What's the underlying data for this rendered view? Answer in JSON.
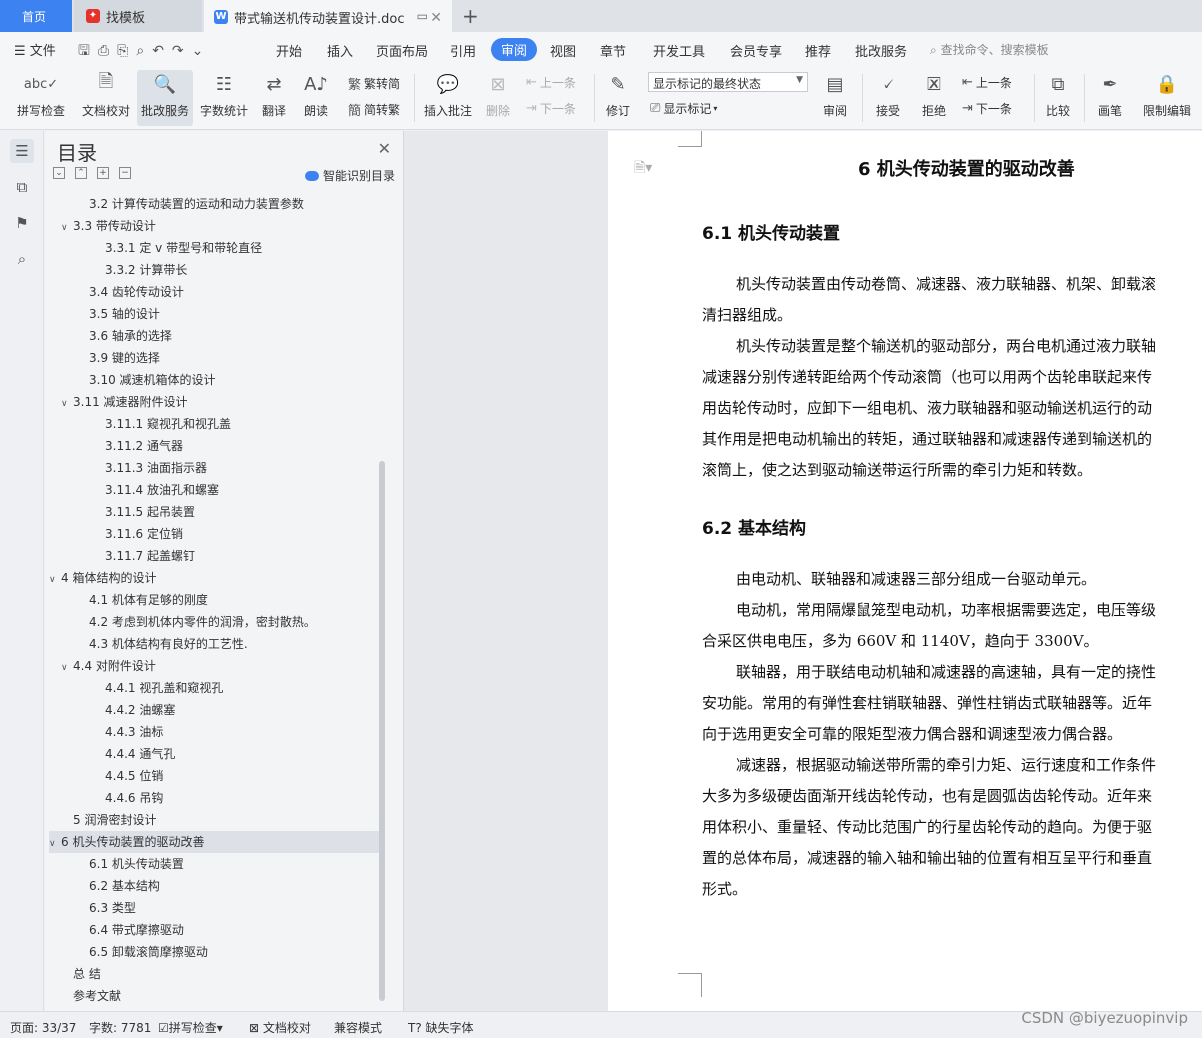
{
  "tabs": {
    "home": "首页",
    "find_template": "找模板",
    "document": "带式输送机传动装置设计.doc"
  },
  "menubar": {
    "file": "文件",
    "items": [
      "开始",
      "插入",
      "页面布局",
      "引用",
      "审阅",
      "视图",
      "章节",
      "开发工具",
      "会员专享",
      "推荐",
      "批改服务"
    ],
    "active": "审阅",
    "search": "查找命令、搜索模板"
  },
  "ribbon": {
    "spellcheck": "拼写检查",
    "doc_proof": "文档校对",
    "grading": "批改服务",
    "word_count": "字数统计",
    "translate": "翻译",
    "read_aloud": "朗读",
    "trad_to_simp": "繁转简",
    "simp_to_trad": "简转繁",
    "insert_comment": "插入批注",
    "delete": "删除",
    "prev_comment": "上一条",
    "next_comment": "下一条",
    "track": "修订",
    "markup_select": "显示标记的最终状态",
    "show_markup": "显示标记",
    "review": "审阅",
    "accept": "接受",
    "reject": "拒绝",
    "prev_change": "上一条",
    "next_change": "下一条",
    "compare": "比较",
    "ink": "画笔",
    "restrict": "限制编辑"
  },
  "toc": {
    "title": "目录",
    "smart": "智能识别目录",
    "items": [
      {
        "text": "3.2 计算传动装置的运动和动力装置参数",
        "level": 2,
        "arrow": ""
      },
      {
        "text": "3.3 带传动设计",
        "level": 2,
        "arrow": "v"
      },
      {
        "text": "3.3.1 定 v 带型号和带轮直径",
        "level": 3,
        "arrow": ""
      },
      {
        "text": "3.3.2 计算带长",
        "level": 3,
        "arrow": ""
      },
      {
        "text": "3.4 齿轮传动设计",
        "level": 2,
        "arrow": ""
      },
      {
        "text": "3.5 轴的设计",
        "level": 2,
        "arrow": ""
      },
      {
        "text": "3.6 轴承的选择",
        "level": 2,
        "arrow": ""
      },
      {
        "text": "3.9 键的选择",
        "level": 2,
        "arrow": ""
      },
      {
        "text": "3.10 减速机箱体的设计",
        "level": 2,
        "arrow": ""
      },
      {
        "text": "3.11 减速器附件设计",
        "level": 2,
        "arrow": "v"
      },
      {
        "text": "3.11.1 窥视孔和视孔盖",
        "level": 3,
        "arrow": ""
      },
      {
        "text": "3.11.2 通气器",
        "level": 3,
        "arrow": ""
      },
      {
        "text": "3.11.3 油面指示器",
        "level": 3,
        "arrow": ""
      },
      {
        "text": "3.11.4 放油孔和螺塞",
        "level": 3,
        "arrow": ""
      },
      {
        "text": "3.11.5 起吊装置",
        "level": 3,
        "arrow": ""
      },
      {
        "text": "3.11.6 定位销",
        "level": 3,
        "arrow": ""
      },
      {
        "text": "3.11.7 起盖螺钉",
        "level": 3,
        "arrow": ""
      },
      {
        "text": "4 箱体结构的设计",
        "level": 1,
        "arrow": "v"
      },
      {
        "text": "4.1  机体有足够的刚度",
        "level": 2,
        "arrow": ""
      },
      {
        "text": "4.2 考虑到机体内零件的润滑，密封散热。",
        "level": 2,
        "arrow": ""
      },
      {
        "text": "4.3 机体结构有良好的工艺性.",
        "level": 2,
        "arrow": ""
      },
      {
        "text": "4.4 对附件设计",
        "level": 2,
        "arrow": "v"
      },
      {
        "text": "4.4.1 视孔盖和窥视孔",
        "level": 3,
        "arrow": ""
      },
      {
        "text": "4.4.2  油螺塞",
        "level": 3,
        "arrow": ""
      },
      {
        "text": "4.4.3 油标",
        "level": 3,
        "arrow": ""
      },
      {
        "text": "4.4.4  通气孔",
        "level": 3,
        "arrow": ""
      },
      {
        "text": "4.4.5 位销",
        "level": 3,
        "arrow": ""
      },
      {
        "text": "4.4.6  吊钩",
        "level": 3,
        "arrow": ""
      },
      {
        "text": "5  润滑密封设计",
        "level": 1,
        "arrow": ""
      },
      {
        "text": "6 机头传动装置的驱动改善",
        "level": 1,
        "arrow": "v",
        "selected": true
      },
      {
        "text": "6.1 机头传动装置",
        "level": 2,
        "arrow": ""
      },
      {
        "text": "6.2 基本结构",
        "level": 2,
        "arrow": ""
      },
      {
        "text": "6.3 类型",
        "level": 2,
        "arrow": ""
      },
      {
        "text": "6.4 带式摩擦驱动",
        "level": 2,
        "arrow": ""
      },
      {
        "text": "6.5 卸载滚筒摩擦驱动",
        "level": 2,
        "arrow": ""
      },
      {
        "text": "总   结",
        "level": 1,
        "arrow": ""
      },
      {
        "text": "参考文献",
        "level": 1,
        "arrow": ""
      }
    ]
  },
  "document": {
    "title": "6 机头传动装置的驱动改善",
    "h1": "6.1 机头传动装置",
    "s1": [
      {
        "text": "机头传动装置由传动卷筒、减速器、液力联轴器、机架、卸载滚",
        "indent": true
      },
      {
        "text": "清扫器组成。",
        "indent": false
      },
      {
        "text": "机头传动装置是整个输送机的驱动部分，两台电机通过液力联轴",
        "indent": true
      },
      {
        "text": "减速器分别传递转距给两个传动滚筒（也可以用两个齿轮串联起来传",
        "indent": false
      },
      {
        "text": "用齿轮传动时，应卸下一组电机、液力联轴器和驱动输送机运行的动",
        "indent": false
      },
      {
        "text": "其作用是把电动机输出的转矩，通过联轴器和减速器传递到输送机的",
        "indent": false
      },
      {
        "text": "滚筒上，使之达到驱动输送带运行所需的牵引力矩和转数。",
        "indent": false
      }
    ],
    "h2": "6.2 基本结构",
    "s2": [
      {
        "text": "由电动机、联轴器和减速器三部分组成一台驱动单元。",
        "indent": true
      },
      {
        "text": "电动机，常用隔爆鼠笼型电动机，功率根据需要选定，电压等级",
        "indent": true
      },
      {
        "text": "合采区供电电压，多为 660V 和  1140V，趋向于 3300V。",
        "indent": false
      },
      {
        "text": "联轴器，用于联结电动机轴和减速器的高速轴，具有一定的挠性",
        "indent": true
      },
      {
        "text": "安功能。常用的有弹性套柱销联轴器、弹性柱销齿式联轴器等。近年",
        "indent": false
      },
      {
        "text": "向于选用更安全可靠的限矩型液力偶合器和调速型液力偶合器。",
        "indent": false
      },
      {
        "text": "减速器，根据驱动输送带所需的牵引力矩、运行速度和工作条件",
        "indent": true
      },
      {
        "text": "大多为多级硬齿面渐开线齿轮传动，也有是圆弧齿齿轮传动。近年来",
        "indent": false
      },
      {
        "text": "用体积小、重量轻、传动比范围广的行星齿轮传动的趋向。为便于驱",
        "indent": false
      },
      {
        "text": "置的总体布局，减速器的输入轴和输出轴的位置有相互呈平行和垂直",
        "indent": false
      },
      {
        "text": "形式。",
        "indent": false
      }
    ]
  },
  "status": {
    "page": "页面: 33/37",
    "words": "字数: 7781",
    "spellcheck": "拼写检查",
    "doc_proof": "文档校对",
    "compat": "兼容模式",
    "missing_font": "缺失字体"
  },
  "watermark": "CSDN @biyezuopinvip",
  "colors": {
    "accent": "#3c82f0",
    "tab_red": "#e5322d"
  }
}
